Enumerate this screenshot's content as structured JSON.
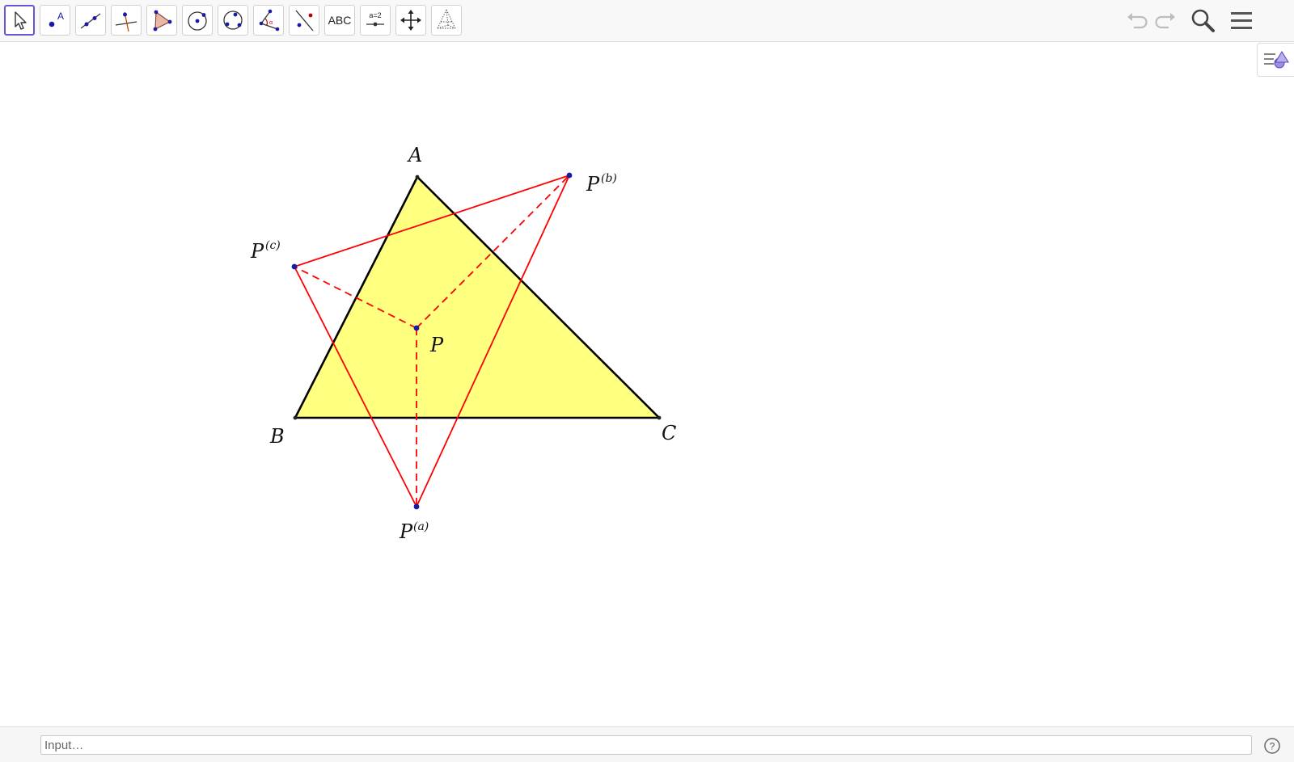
{
  "toolbar": {
    "tools": [
      {
        "icon": "move-arrow-icon",
        "selected": true
      },
      {
        "icon": "point-icon",
        "glyph": "A"
      },
      {
        "icon": "line-icon"
      },
      {
        "icon": "perpendicular-line-icon"
      },
      {
        "icon": "polygon-icon"
      },
      {
        "icon": "circle-center-point-icon"
      },
      {
        "icon": "circle-three-points-icon"
      },
      {
        "icon": "angle-icon"
      },
      {
        "icon": "reflect-about-line-icon"
      },
      {
        "icon": "text-icon",
        "label": "ABC"
      },
      {
        "icon": "slider-icon",
        "label": "a=2"
      },
      {
        "icon": "move-graphics-view-icon"
      },
      {
        "icon": "3d-graphics-icon"
      }
    ],
    "right_buttons": [
      "undo-icon",
      "redo-icon",
      "search-icon",
      "menu-icon"
    ]
  },
  "graphics": {
    "points": {
      "A": {
        "label": "A"
      },
      "B": {
        "label": "B"
      },
      "C": {
        "label": "C"
      },
      "P": {
        "label": "P"
      },
      "Pa": {
        "label": "P",
        "superscript": "(a)"
      },
      "Pb": {
        "label": "P",
        "superscript": "(b)"
      },
      "Pc": {
        "label": "P",
        "superscript": "(c)"
      }
    },
    "colors": {
      "triangle_fill": "#ffff80",
      "triangle_stroke": "#000000",
      "red_lines": "#ff0000",
      "point": "#1a1aa6"
    }
  },
  "style_bar": {
    "icon": "style-bar-toggle-icon"
  },
  "input_bar": {
    "placeholder": "Input…",
    "help_icon": "help-icon"
  }
}
